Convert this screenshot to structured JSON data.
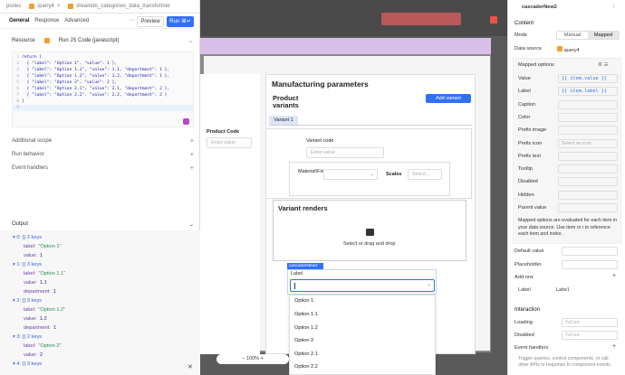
{
  "left": {
    "tabs": [
      {
        "label": "pories"
      },
      {
        "label": "query4"
      },
      {
        "label": "dreamdo_categories_data_transformer"
      }
    ],
    "subtabs": [
      "General",
      "Response",
      "Advanced"
    ],
    "preview_label": "Preview",
    "run_label": "Run ⌘↵",
    "resource_label": "Resource",
    "resource_value": "Run JS Code (javascript)",
    "code_lines": [
      "return [",
      "  { \"label\": \"Option 1\", \"value\": 1 },",
      "  { \"label\": \"Option 1.1\", \"value\": 1.1, \"department\": 1 },",
      "  { \"label\": \"Option 1.2\", \"value\": 1.2, \"department\": 1 },",
      "  { \"label\": \"Option 2\", \"value\": 2 },",
      "  { \"label\": \"Option 2.1\", \"value\": 2.1, \"department\": 2 },",
      "  { \"label\": \"Option 2.2\", \"value\": 2.2, \"department\": 2 }",
      "]",
      ""
    ],
    "line_numbers": [
      "1",
      "2",
      "3",
      "4",
      "5",
      "6",
      "7",
      "8",
      "9"
    ],
    "sections": [
      "Additional scope",
      "Run behavior",
      "Event handlers"
    ],
    "output_label": "Output",
    "tree": [
      {
        "type": "hdr",
        "text": "▾ 0: {} 2 keys"
      },
      {
        "type": "kv",
        "key": "label:",
        "val": "\"Option 1\""
      },
      {
        "type": "kv",
        "key": "value:",
        "val": "1"
      },
      {
        "type": "hdr",
        "text": "▾ 1: {} 3 keys"
      },
      {
        "type": "kv",
        "key": "label:",
        "val": "\"Option 1.1\""
      },
      {
        "type": "kv",
        "key": "value:",
        "val": "1.1"
      },
      {
        "type": "kv",
        "key": "department:",
        "val": "1"
      },
      {
        "type": "hdr",
        "text": "▾ 2: {} 3 keys"
      },
      {
        "type": "kv",
        "key": "label:",
        "val": "\"Option 1.2\""
      },
      {
        "type": "kv",
        "key": "value:",
        "val": "1.2"
      },
      {
        "type": "kv",
        "key": "department:",
        "val": "1"
      },
      {
        "type": "hdr",
        "text": "▾ 3: {} 2 keys"
      },
      {
        "type": "kv",
        "key": "label:",
        "val": "\"Option 2\""
      },
      {
        "type": "kv",
        "key": "value:",
        "val": "2"
      },
      {
        "type": "hdr",
        "text": "▾ 4: {} 3 keys"
      }
    ]
  },
  "canvas": {
    "product_code_label": "Product Code",
    "enter_value": "Enter value",
    "mfg_title": "Manufacturing parameters",
    "product_variants": "Product variants",
    "add_variant": "Add variant",
    "variant_tab": "Variant 1",
    "variant_code_label": "Variant code",
    "material_finish": "Material\\Finish",
    "scales": "Scales",
    "select_placeholder": "Select...",
    "variant_renders": "Variant renders",
    "drop_text": "Select or drag and drop",
    "cascader_tag": "cascaderNew2",
    "label_text": "Label",
    "options": [
      "Option 1",
      "Option 1.1",
      "Option 1.2",
      "Option 2",
      "Option 2.1",
      "Option 2.2"
    ],
    "zoom": "100%"
  },
  "right": {
    "component_name": "cascaderNew2",
    "content": "Content",
    "mode_label": "Mode",
    "mode_manual": "Manual",
    "mode_mapped": "Mapped",
    "data_source_label": "Data source",
    "data_source_value": "query4",
    "mapped_options": "Mapped options",
    "fields": [
      {
        "label": "Value",
        "value": "{{ item.value }}"
      },
      {
        "label": "Label",
        "value": "{{ item.label }}"
      },
      {
        "label": "Caption",
        "value": ""
      },
      {
        "label": "Color",
        "value": ""
      },
      {
        "label": "Prefix image",
        "value": ""
      },
      {
        "label": "Prefix icon",
        "value": "Select an icon"
      },
      {
        "label": "Prefix text",
        "value": ""
      },
      {
        "label": "Tooltip",
        "value": ""
      },
      {
        "label": "Disabled",
        "value": ""
      },
      {
        "label": "Hidden",
        "value": ""
      },
      {
        "label": "Parent value",
        "value": ""
      }
    ],
    "note": "Mapped options are evaluated for each item in your data source. Use item or i to reference each item and index.",
    "default_value": "Default value",
    "placeholder": "Placeholder",
    "addons": "Add-ons",
    "addon_label": "Label",
    "addon_label_val": "Label",
    "interaction": "Interaction",
    "loading": "Loading",
    "loading_val": "false",
    "disabled": "Disabled",
    "disabled_val": "false",
    "event_handlers": "Event handlers",
    "event_note": "Trigger queries, control components, or call other APIs in response to component events."
  }
}
